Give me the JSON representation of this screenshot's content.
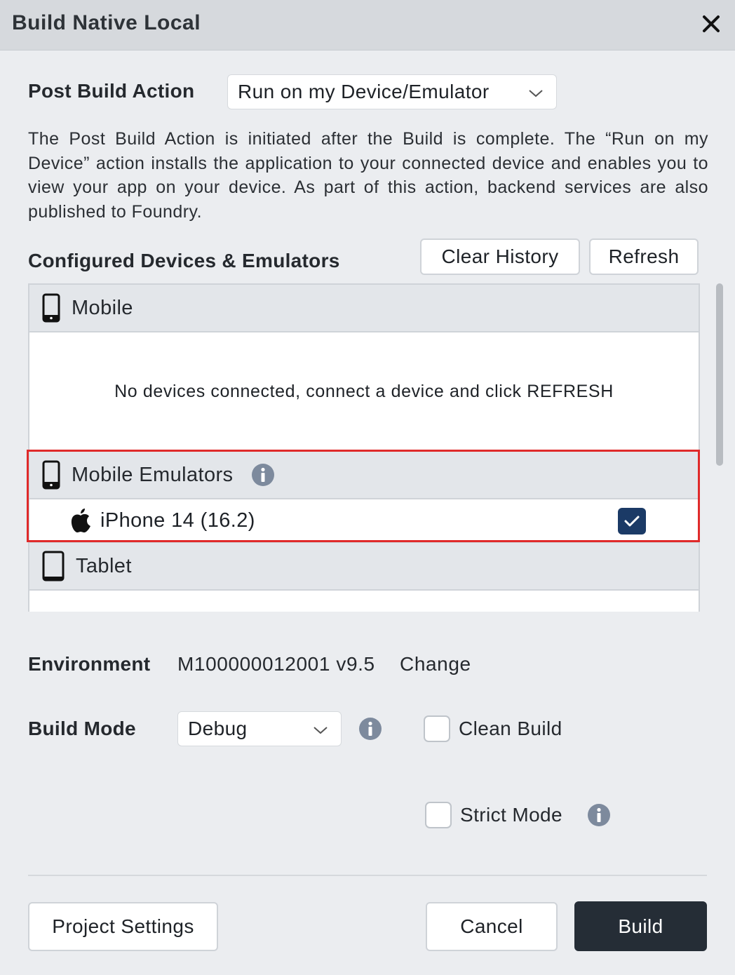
{
  "dialog": {
    "title": "Build Native Local",
    "close_icon": "close-icon"
  },
  "post_build": {
    "label": "Post Build Action",
    "selected": "Run on my Device/Emulator",
    "description": "The Post Build Action is initiated after the Build is complete. The “Run on my Device” action installs the application to your connected device and enables you to view your app on your device. As part of this action, backend services are also published to Foundry."
  },
  "devices": {
    "label": "Configured Devices & Emulators",
    "clear_history_label": "Clear History",
    "refresh_label": "Refresh",
    "groups": [
      {
        "name": "Mobile",
        "icon": "mobile-phone-icon"
      },
      {
        "name": "Mobile Emulators",
        "icon": "mobile-phone-icon"
      },
      {
        "name": "Tablet",
        "icon": "tablet-icon"
      }
    ],
    "mobile_empty_message": "No devices connected, connect a device and click REFRESH",
    "emulators": [
      {
        "name": "iPhone 14 (16.2)",
        "icon": "apple-icon",
        "checked": true
      }
    ]
  },
  "environment": {
    "label": "Environment",
    "value": "M100000012001 v9.5",
    "change_label": "Change"
  },
  "build_mode": {
    "label": "Build Mode",
    "selected": "Debug",
    "clean_build_label": "Clean Build",
    "clean_build_checked": false,
    "strict_mode_label": "Strict Mode",
    "strict_mode_checked": false
  },
  "footer": {
    "project_settings_label": "Project Settings",
    "cancel_label": "Cancel",
    "build_label": "Build"
  },
  "colors": {
    "highlight": "#e02a2a",
    "primary_button": "#252d36",
    "checkbox_checked": "#1b3a66",
    "info_icon": "#7d8a9d"
  }
}
